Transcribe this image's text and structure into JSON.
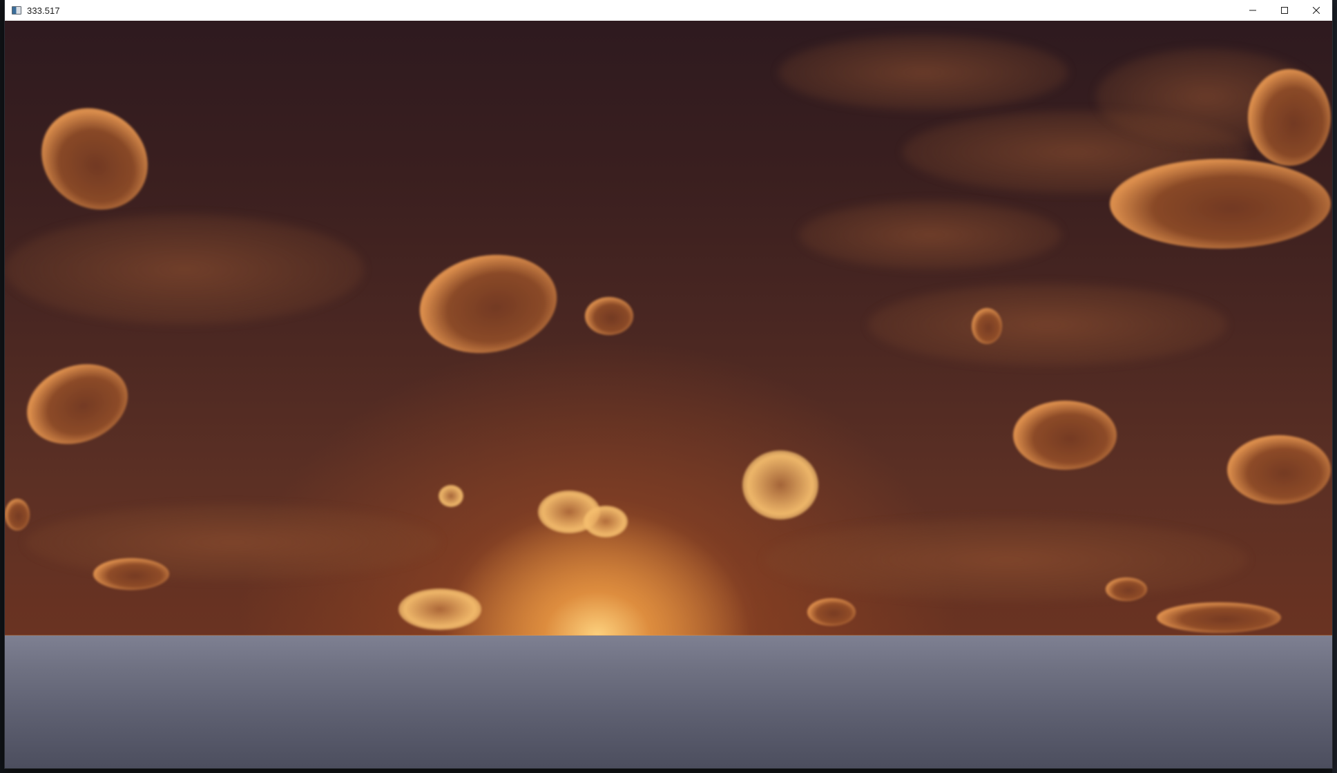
{
  "window": {
    "title": "333.517",
    "app_icon": "app-window-icon",
    "controls": {
      "minimize_icon": "minimize-icon",
      "maximize_icon": "maximize-icon",
      "close_icon": "close-icon"
    }
  },
  "scene": {
    "description_type": "rendered-3d-viewport",
    "sky_color": "#3a1f1f",
    "sun_color": "#f5c27a",
    "sea_color": "#6f7182"
  }
}
